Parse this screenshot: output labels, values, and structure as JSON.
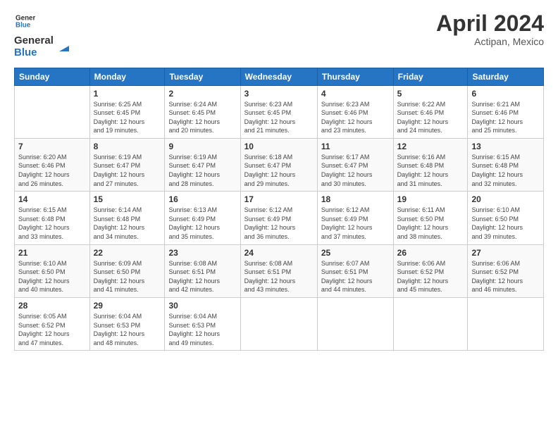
{
  "logo": {
    "line1": "General",
    "line2": "Blue"
  },
  "title": "April 2024",
  "subtitle": "Actipan, Mexico",
  "header": {
    "days": [
      "Sunday",
      "Monday",
      "Tuesday",
      "Wednesday",
      "Thursday",
      "Friday",
      "Saturday"
    ]
  },
  "weeks": [
    [
      {
        "day": "",
        "info": ""
      },
      {
        "day": "1",
        "info": "Sunrise: 6:25 AM\nSunset: 6:45 PM\nDaylight: 12 hours\nand 19 minutes."
      },
      {
        "day": "2",
        "info": "Sunrise: 6:24 AM\nSunset: 6:45 PM\nDaylight: 12 hours\nand 20 minutes."
      },
      {
        "day": "3",
        "info": "Sunrise: 6:23 AM\nSunset: 6:45 PM\nDaylight: 12 hours\nand 21 minutes."
      },
      {
        "day": "4",
        "info": "Sunrise: 6:23 AM\nSunset: 6:46 PM\nDaylight: 12 hours\nand 23 minutes."
      },
      {
        "day": "5",
        "info": "Sunrise: 6:22 AM\nSunset: 6:46 PM\nDaylight: 12 hours\nand 24 minutes."
      },
      {
        "day": "6",
        "info": "Sunrise: 6:21 AM\nSunset: 6:46 PM\nDaylight: 12 hours\nand 25 minutes."
      }
    ],
    [
      {
        "day": "7",
        "info": "Sunrise: 6:20 AM\nSunset: 6:46 PM\nDaylight: 12 hours\nand 26 minutes."
      },
      {
        "day": "8",
        "info": "Sunrise: 6:19 AM\nSunset: 6:47 PM\nDaylight: 12 hours\nand 27 minutes."
      },
      {
        "day": "9",
        "info": "Sunrise: 6:19 AM\nSunset: 6:47 PM\nDaylight: 12 hours\nand 28 minutes."
      },
      {
        "day": "10",
        "info": "Sunrise: 6:18 AM\nSunset: 6:47 PM\nDaylight: 12 hours\nand 29 minutes."
      },
      {
        "day": "11",
        "info": "Sunrise: 6:17 AM\nSunset: 6:47 PM\nDaylight: 12 hours\nand 30 minutes."
      },
      {
        "day": "12",
        "info": "Sunrise: 6:16 AM\nSunset: 6:48 PM\nDaylight: 12 hours\nand 31 minutes."
      },
      {
        "day": "13",
        "info": "Sunrise: 6:15 AM\nSunset: 6:48 PM\nDaylight: 12 hours\nand 32 minutes."
      }
    ],
    [
      {
        "day": "14",
        "info": "Sunrise: 6:15 AM\nSunset: 6:48 PM\nDaylight: 12 hours\nand 33 minutes."
      },
      {
        "day": "15",
        "info": "Sunrise: 6:14 AM\nSunset: 6:48 PM\nDaylight: 12 hours\nand 34 minutes."
      },
      {
        "day": "16",
        "info": "Sunrise: 6:13 AM\nSunset: 6:49 PM\nDaylight: 12 hours\nand 35 minutes."
      },
      {
        "day": "17",
        "info": "Sunrise: 6:12 AM\nSunset: 6:49 PM\nDaylight: 12 hours\nand 36 minutes."
      },
      {
        "day": "18",
        "info": "Sunrise: 6:12 AM\nSunset: 6:49 PM\nDaylight: 12 hours\nand 37 minutes."
      },
      {
        "day": "19",
        "info": "Sunrise: 6:11 AM\nSunset: 6:50 PM\nDaylight: 12 hours\nand 38 minutes."
      },
      {
        "day": "20",
        "info": "Sunrise: 6:10 AM\nSunset: 6:50 PM\nDaylight: 12 hours\nand 39 minutes."
      }
    ],
    [
      {
        "day": "21",
        "info": "Sunrise: 6:10 AM\nSunset: 6:50 PM\nDaylight: 12 hours\nand 40 minutes."
      },
      {
        "day": "22",
        "info": "Sunrise: 6:09 AM\nSunset: 6:50 PM\nDaylight: 12 hours\nand 41 minutes."
      },
      {
        "day": "23",
        "info": "Sunrise: 6:08 AM\nSunset: 6:51 PM\nDaylight: 12 hours\nand 42 minutes."
      },
      {
        "day": "24",
        "info": "Sunrise: 6:08 AM\nSunset: 6:51 PM\nDaylight: 12 hours\nand 43 minutes."
      },
      {
        "day": "25",
        "info": "Sunrise: 6:07 AM\nSunset: 6:51 PM\nDaylight: 12 hours\nand 44 minutes."
      },
      {
        "day": "26",
        "info": "Sunrise: 6:06 AM\nSunset: 6:52 PM\nDaylight: 12 hours\nand 45 minutes."
      },
      {
        "day": "27",
        "info": "Sunrise: 6:06 AM\nSunset: 6:52 PM\nDaylight: 12 hours\nand 46 minutes."
      }
    ],
    [
      {
        "day": "28",
        "info": "Sunrise: 6:05 AM\nSunset: 6:52 PM\nDaylight: 12 hours\nand 47 minutes."
      },
      {
        "day": "29",
        "info": "Sunrise: 6:04 AM\nSunset: 6:53 PM\nDaylight: 12 hours\nand 48 minutes."
      },
      {
        "day": "30",
        "info": "Sunrise: 6:04 AM\nSunset: 6:53 PM\nDaylight: 12 hours\nand 49 minutes."
      },
      {
        "day": "",
        "info": ""
      },
      {
        "day": "",
        "info": ""
      },
      {
        "day": "",
        "info": ""
      },
      {
        "day": "",
        "info": ""
      }
    ]
  ]
}
